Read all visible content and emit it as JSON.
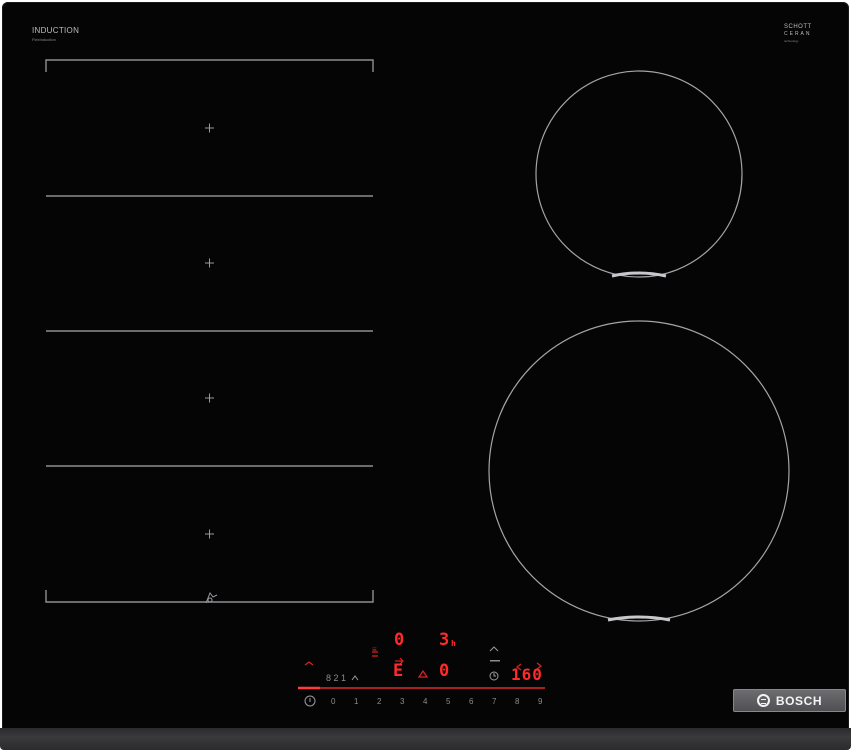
{
  "top_left_label": {
    "title": "INDUCTION",
    "subtitle": "FlexInduction"
  },
  "top_right_label": {
    "line1": "SCHOTT",
    "line2": "CERAN",
    "line3": "technology"
  },
  "displays": {
    "zone_top_left": "0",
    "zone_top_right": "3",
    "zone_top_right_suffix": "h",
    "zone_mid_left": "E",
    "zone_mid_right": "0",
    "timer": "160"
  },
  "power_scale": [
    "0",
    "1",
    "2",
    "3",
    "4",
    "5",
    "6",
    "7",
    "8",
    "9"
  ],
  "control_labels": {
    "boost": "8 2 1",
    "mode": "≡"
  },
  "brand": {
    "name": "BOSCH"
  },
  "colors": {
    "glass": "#050506",
    "display_red": "#ff2a2a",
    "line_grey": "#8f8f92"
  }
}
